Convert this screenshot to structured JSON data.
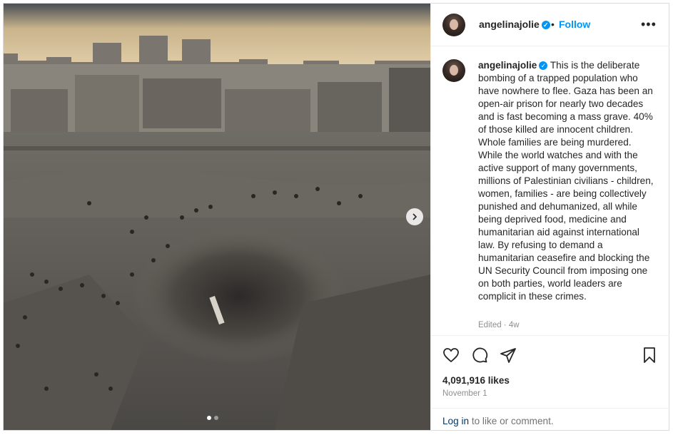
{
  "header": {
    "username": "angelinajolie",
    "separator": "•",
    "follow_label": "Follow",
    "more_icon": "more-horizontal-icon"
  },
  "caption": {
    "username": "angelinajolie",
    "text": "This is the deliberate bombing of a trapped population who have nowhere to flee. Gaza has been an open-air prison for nearly two decades and is fast becoming a mass grave. 40% of those killed are innocent children. Whole families are being murdered. While the world watches and with the active support of many governments, millions of Palestinian civilians - children, women, families - are being collectively punished and dehumanized, all while being deprived food, medicine and humanitarian aid against international law. By refusing to demand a humanitarian ceasefire and blocking the UN Security Council from imposing one on both parties, world leaders are complicit in these crimes.",
    "edited": "Edited · 4w"
  },
  "media": {
    "description_icon": "photo",
    "carousel_total": 2,
    "carousel_active": 1
  },
  "stats": {
    "likes": "4,091,916 likes",
    "date": "November 1"
  },
  "footer": {
    "login_link": "Log in",
    "login_rest": " to like or comment."
  },
  "colors": {
    "accent": "#0095f6",
    "text": "#262626",
    "muted": "#8e8e8e",
    "link": "#00376b"
  }
}
